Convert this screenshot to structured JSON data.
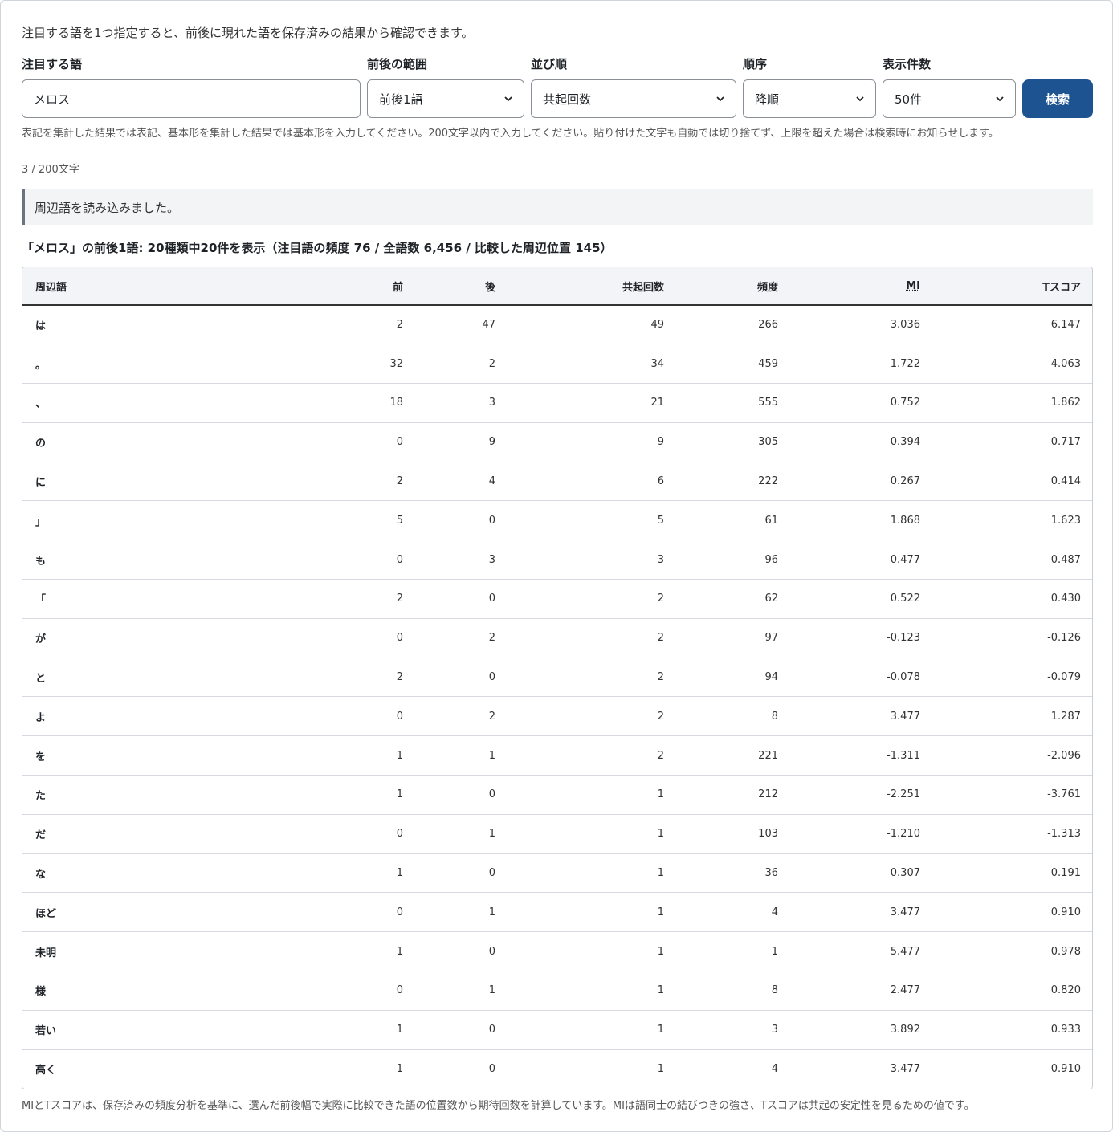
{
  "intro": "注目する語を1つ指定すると、前後に現れた語を保存済みの結果から確認できます。",
  "form": {
    "target_label": "注目する語",
    "target_value": "メロス",
    "range_label": "前後の範囲",
    "range_value": "前後1語",
    "sort_label": "並び順",
    "sort_value": "共起回数",
    "order_label": "順序",
    "order_value": "降順",
    "limit_label": "表示件数",
    "limit_value": "50件",
    "search_label": "検索",
    "help": "表記を集計した結果では表記、基本形を集計した結果では基本形を入力してください。200文字以内で入力してください。貼り付けた文字も自動では切り捨てず、上限を超えた場合は検索時にお知らせします。",
    "char_count": "3 / 200文字"
  },
  "status": "周辺語を読み込みました。",
  "summary": "「メロス」の前後1語: 20種類中20件を表示（注目語の頻度 76 / 全語数 6,456 / 比較した周辺位置 145）",
  "table": {
    "headers": [
      "周辺語",
      "前",
      "後",
      "共起回数",
      "頻度",
      "MI",
      "Tスコア"
    ],
    "rows": [
      [
        "は",
        "2",
        "47",
        "49",
        "266",
        "3.036",
        "6.147"
      ],
      [
        "。",
        "32",
        "2",
        "34",
        "459",
        "1.722",
        "4.063"
      ],
      [
        "、",
        "18",
        "3",
        "21",
        "555",
        "0.752",
        "1.862"
      ],
      [
        "の",
        "0",
        "9",
        "9",
        "305",
        "0.394",
        "0.717"
      ],
      [
        "に",
        "2",
        "4",
        "6",
        "222",
        "0.267",
        "0.414"
      ],
      [
        "」",
        "5",
        "0",
        "5",
        "61",
        "1.868",
        "1.623"
      ],
      [
        "も",
        "0",
        "3",
        "3",
        "96",
        "0.477",
        "0.487"
      ],
      [
        "「",
        "2",
        "0",
        "2",
        "62",
        "0.522",
        "0.430"
      ],
      [
        "が",
        "0",
        "2",
        "2",
        "97",
        "-0.123",
        "-0.126"
      ],
      [
        "と",
        "2",
        "0",
        "2",
        "94",
        "-0.078",
        "-0.079"
      ],
      [
        "よ",
        "0",
        "2",
        "2",
        "8",
        "3.477",
        "1.287"
      ],
      [
        "を",
        "1",
        "1",
        "2",
        "221",
        "-1.311",
        "-2.096"
      ],
      [
        "た",
        "1",
        "0",
        "1",
        "212",
        "-2.251",
        "-3.761"
      ],
      [
        "だ",
        "0",
        "1",
        "1",
        "103",
        "-1.210",
        "-1.313"
      ],
      [
        "な",
        "1",
        "0",
        "1",
        "36",
        "0.307",
        "0.191"
      ],
      [
        "ほど",
        "0",
        "1",
        "1",
        "4",
        "3.477",
        "0.910"
      ],
      [
        "未明",
        "1",
        "0",
        "1",
        "1",
        "5.477",
        "0.978"
      ],
      [
        "様",
        "0",
        "1",
        "1",
        "8",
        "2.477",
        "0.820"
      ],
      [
        "若い",
        "1",
        "0",
        "1",
        "3",
        "3.892",
        "0.933"
      ],
      [
        "高く",
        "1",
        "0",
        "1",
        "4",
        "3.477",
        "0.910"
      ]
    ]
  },
  "footnote": "MIとTスコアは、保存済みの頻度分析を基準に、選んだ前後幅で実際に比較できた語の位置数から期待回数を計算しています。MIは語同士の結びつきの強さ、Tスコアは共起の安定性を見るための値です。"
}
